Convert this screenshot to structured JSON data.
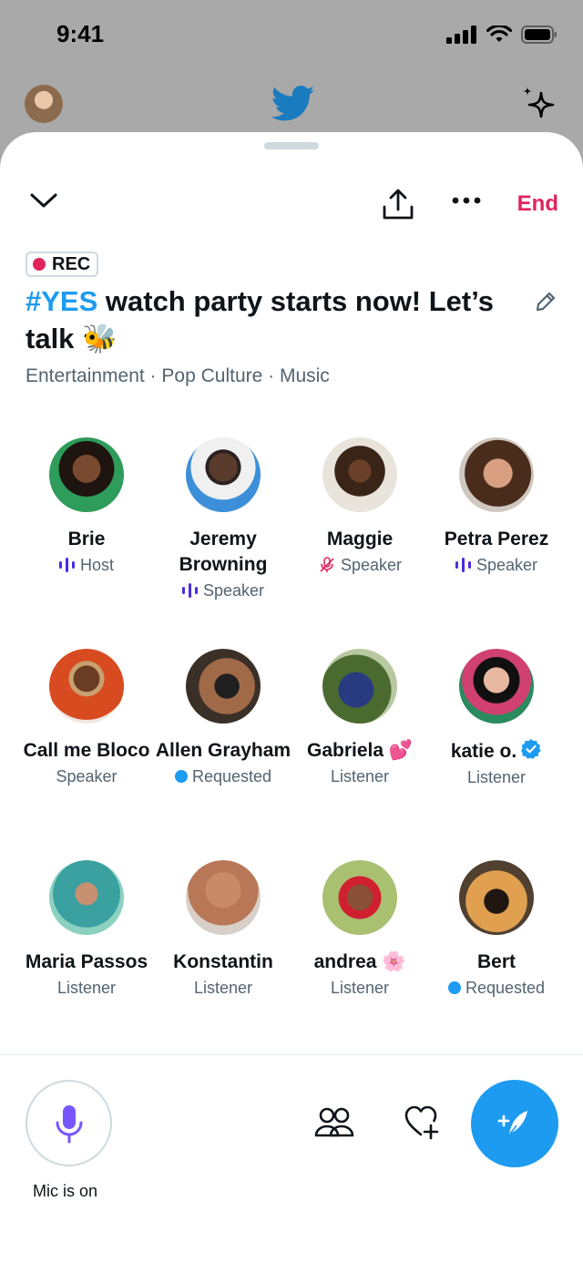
{
  "status_bar": {
    "time": "9:41"
  },
  "header": {
    "end_label": "End"
  },
  "space": {
    "rec_label": "REC",
    "title_hashtag": "#YES",
    "title_rest": " watch party starts now! Let’s talk 🐝",
    "topics": "Entertainment · Pop Culture · Music"
  },
  "participants": [
    {
      "name": "Brie",
      "role": "Host",
      "role_icon": "speaking-bars-icon"
    },
    {
      "name": "Jeremy Browning",
      "role": "Speaker",
      "role_icon": "speaking-bars-icon"
    },
    {
      "name": "Maggie",
      "role": "Speaker",
      "role_icon": "mic-muted-icon"
    },
    {
      "name": "Petra Perez",
      "role": "Speaker",
      "role_icon": "speaking-bars-icon"
    },
    {
      "name": "Call me Bloco",
      "role": "Speaker",
      "role_icon": ""
    },
    {
      "name": "Allen Grayham",
      "role": "Requested",
      "role_icon": "requested-dot"
    },
    {
      "name": "Gabriela 💕",
      "role": "Listener",
      "role_icon": ""
    },
    {
      "name": "katie o.",
      "role": "Listener",
      "role_icon": "",
      "verified": true
    },
    {
      "name": "Maria Passos",
      "role": "Listener",
      "role_icon": ""
    },
    {
      "name": "Konstantin",
      "role": "Listener",
      "role_icon": ""
    },
    {
      "name": "andrea 🌸",
      "role": "Listener",
      "role_icon": ""
    },
    {
      "name": "Bert",
      "role": "Requested",
      "role_icon": "requested-dot"
    }
  ],
  "bottom_bar": {
    "mic_label": "Mic is on"
  },
  "colors": {
    "accent": "#1d9bf0",
    "end": "#e0245e",
    "mic": "#7856ff",
    "speaking": "#4c2ce0"
  },
  "icons": [
    "signal-icon",
    "wifi-icon",
    "battery-icon",
    "twitter-bird-icon",
    "sparkle-icon",
    "chevron-down-icon",
    "share-icon",
    "more-icon",
    "edit-icon",
    "mic-icon",
    "people-icon",
    "heart-plus-icon",
    "compose-icon"
  ]
}
